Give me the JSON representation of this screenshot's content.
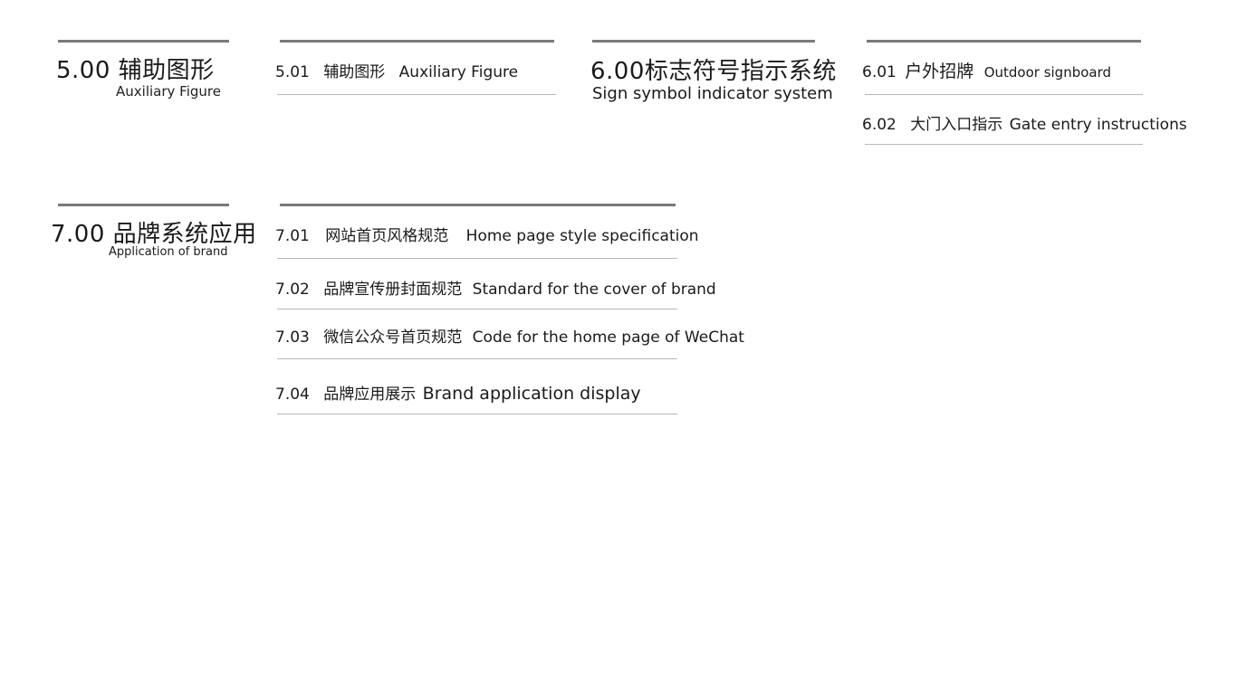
{
  "sections": [
    {
      "number": "5.00",
      "title_cn": "辅助图形",
      "title_en": "Auxiliary Figure",
      "items": [
        {
          "number": "5.01",
          "cn": "辅助图形",
          "en": "Auxiliary Figure"
        }
      ]
    },
    {
      "number": "6.00",
      "title_cn": "标志符号指示系统",
      "title_en": "Sign symbol indicator system",
      "items": [
        {
          "number": "6.01",
          "cn": "户外招牌",
          "en": "Outdoor signboard"
        },
        {
          "number": "6.02",
          "cn": "大门入口指示",
          "en": "Gate entry instructions"
        }
      ]
    },
    {
      "number": "7.00",
      "title_cn": "品牌系统应用",
      "title_en": "Application of brand",
      "items": [
        {
          "number": "7.01",
          "cn": "网站首页风格规范",
          "en": "Home page style specification"
        },
        {
          "number": "7.02",
          "cn": "品牌宣传册封面规范",
          "en": "Standard for the cover of brand"
        },
        {
          "number": "7.03",
          "cn": "微信公众号首页规范",
          "en": "Code for the home page of WeChat"
        },
        {
          "number": "7.04",
          "cn": "品牌应用展示",
          "en": "Brand application display"
        }
      ]
    }
  ]
}
